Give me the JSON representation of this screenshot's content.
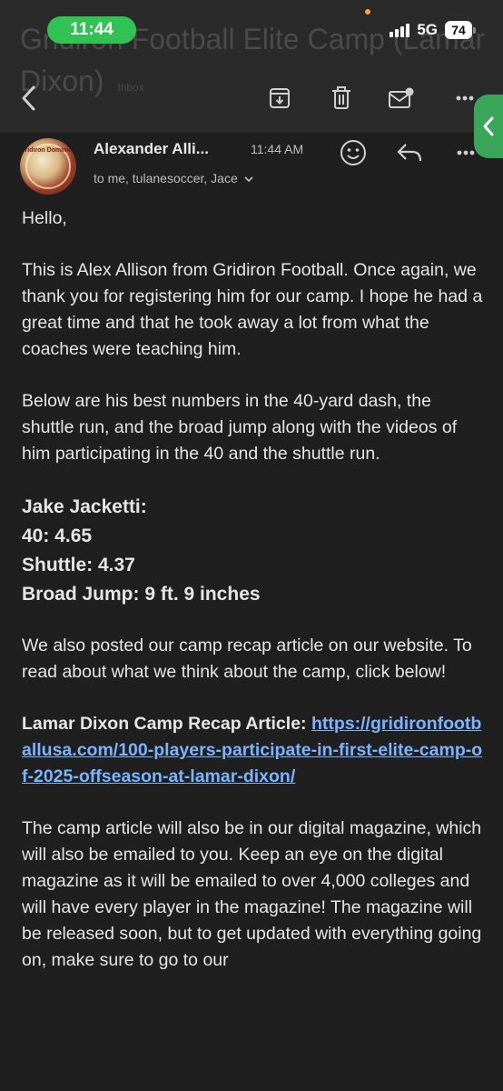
{
  "status_bar": {
    "time": "11:44",
    "network": "5G",
    "battery": "74"
  },
  "ghost": {
    "title": "Gridiron Football Elite Camp (Lamar Dixon)",
    "tag": "Inbox"
  },
  "email": {
    "sender": "Alexander Alli...",
    "time": "11:44 AM",
    "recipients": "to me, tulanesoccer, Jace",
    "avatar_text": "Gridiron Dominion",
    "greeting": "Hello,",
    "paragraph1": "This is Alex Allison from Gridiron Football. Once again, we thank you for registering him for our camp. I hope he had a great time and that he took away a lot from what the coaches were teaching him.",
    "paragraph2": "Below are his best numbers in the 40-yard dash, the shuttle run, and the broad jump along with the videos of him participating in the 40 and the shuttle run.",
    "stats": {
      "name": "Jake Jacketti:",
      "forty": "40: 4.65",
      "shuttle": "Shuttle: 4.37",
      "broad_jump": "Broad Jump: 9 ft. 9 inches"
    },
    "paragraph3": "We also posted our camp recap article on our website. To read about what we think about the camp, click below!",
    "article_label": "Lamar Dixon Camp Recap Article:",
    "article_link": "https://gridironfootballusa.com/100-players-participate-in-first-elite-camp-of-2025-offseason-at-lamar-dixon/",
    "paragraph4": "The camp article will also be in our digital magazine, which will also be emailed to you. Keep an eye on the digital magazine as it will be emailed to over 4,000 colleges and will have every player in the magazine! The magazine will be released soon, but to get updated with everything going on, make sure to go to our"
  },
  "colors": {
    "background": "#1f1f1f",
    "toolbar": "#2a2a2a",
    "link": "#7ab4ff",
    "status_pill": "#30c253",
    "side_tab": "#3aa65a"
  }
}
